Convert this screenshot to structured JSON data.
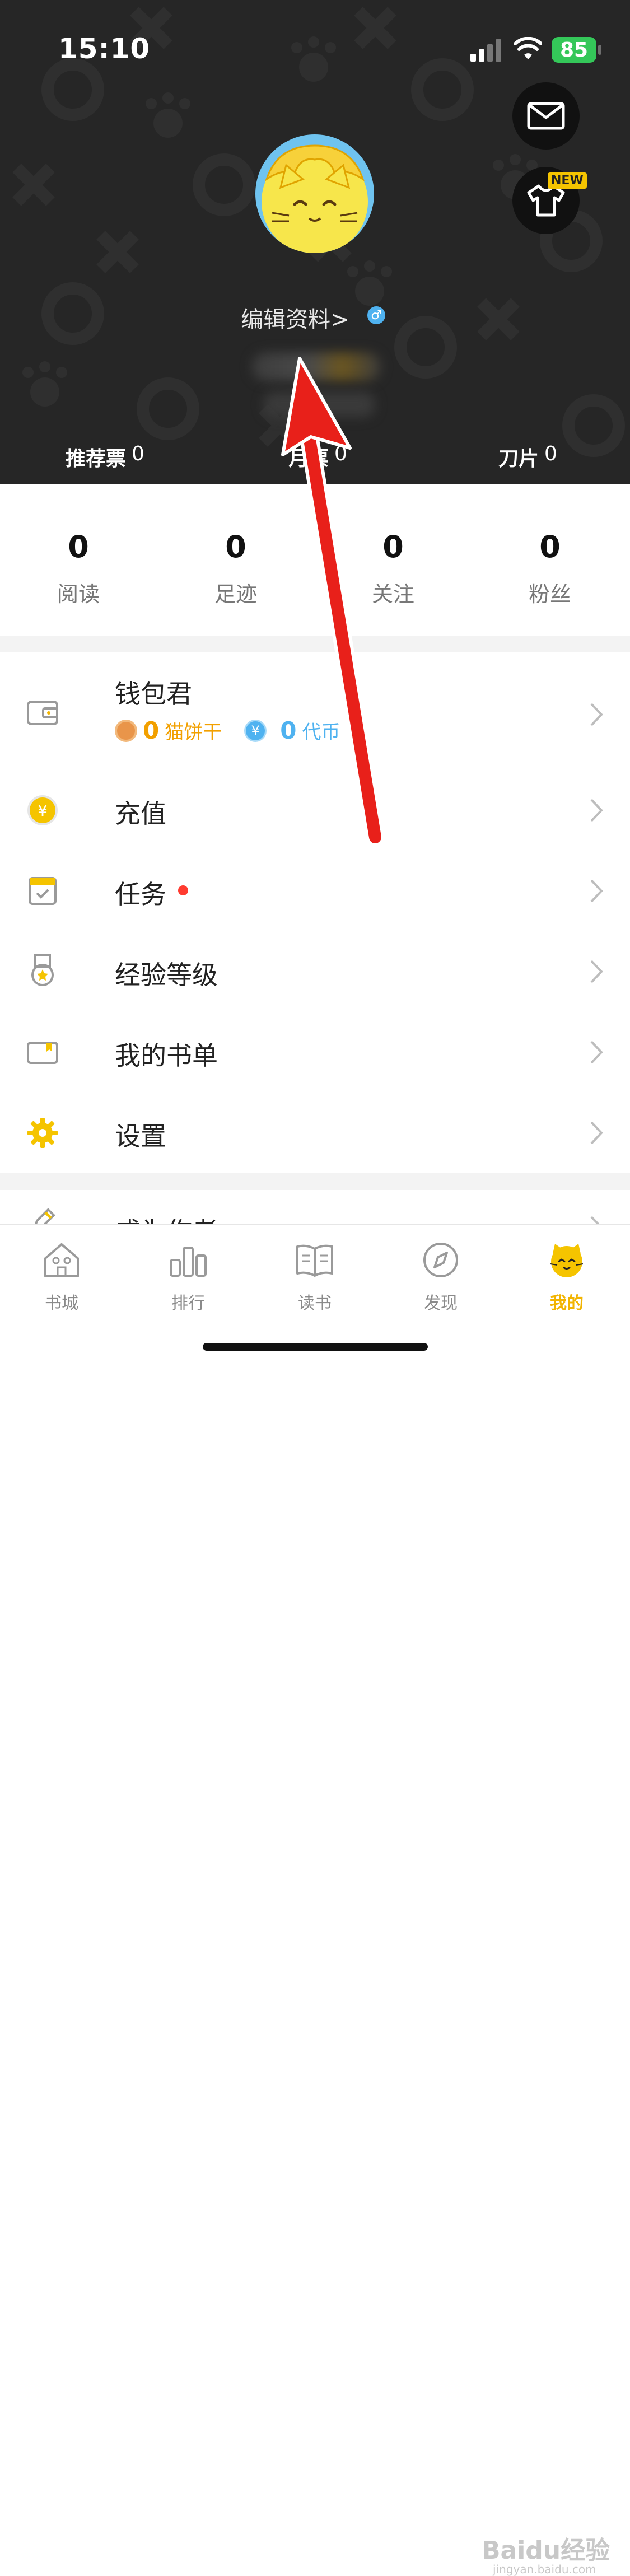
{
  "status_bar": {
    "time": "15:10",
    "battery": "85"
  },
  "header": {
    "new_badge": "NEW",
    "edit_profile": "编辑资料>",
    "gender_symbol": "♂",
    "stats": [
      {
        "label": "推荐票",
        "value": "0"
      },
      {
        "label": "月票",
        "value": "0"
      },
      {
        "label": "刀片",
        "value": "0"
      }
    ]
  },
  "stats": [
    {
      "value": "0",
      "label": "阅读"
    },
    {
      "value": "0",
      "label": "足迹"
    },
    {
      "value": "0",
      "label": "关注"
    },
    {
      "value": "0",
      "label": "粉丝"
    }
  ],
  "wallet": {
    "label": "钱包君",
    "cookie_value": "0",
    "cookie_label": "猫饼干",
    "coin_symbol": "¥",
    "coin_value": "0",
    "coin_label": "代币"
  },
  "menu": [
    {
      "label": "充值",
      "icon": "yuan-coin-icon"
    },
    {
      "label": "任务",
      "icon": "calendar-task-icon",
      "has_dot": true
    },
    {
      "label": "经验等级",
      "icon": "medal-icon"
    },
    {
      "label": "我的书单",
      "icon": "booklist-icon"
    },
    {
      "label": "设置",
      "icon": "gear-icon"
    },
    {
      "label": "成为作者",
      "icon": "pen-icon"
    }
  ],
  "tabs": [
    {
      "label": "书城",
      "icon": "house-icon"
    },
    {
      "label": "排行",
      "icon": "bar-chart-icon"
    },
    {
      "label": "读书",
      "icon": "open-book-icon"
    },
    {
      "label": "发现",
      "icon": "compass-icon"
    },
    {
      "label": "我的",
      "icon": "cat-face-icon",
      "active": true
    }
  ],
  "watermark": {
    "text": "Baidu经验",
    "sub": "jingyan.baidu.com"
  },
  "colors": {
    "accent": "#f2b400",
    "header_bg": "#262626",
    "arrow": "#e8201a"
  }
}
